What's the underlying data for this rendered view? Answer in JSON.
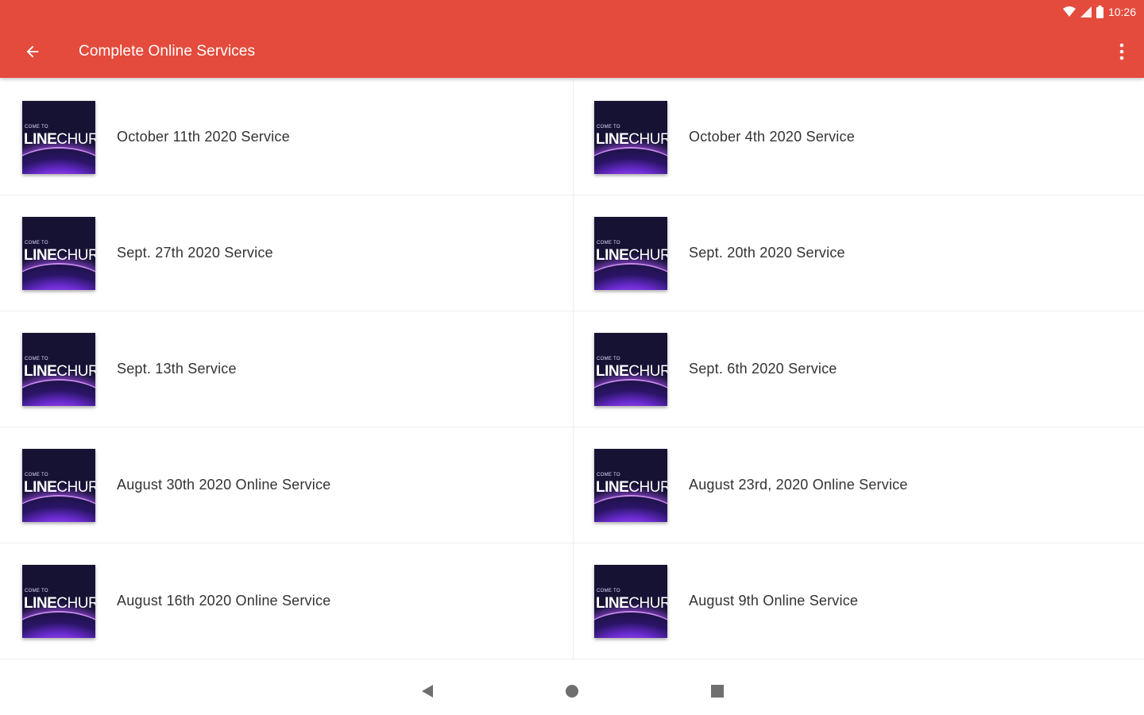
{
  "status_bar": {
    "time": "10:26"
  },
  "toolbar": {
    "title": "Complete Online Services",
    "back_icon": "arrow-back-icon",
    "menu_icon": "more-vert-icon"
  },
  "colors": {
    "accent": "#e44b3c",
    "text": "#333333"
  },
  "thumbnail": {
    "top_text": "COME TO",
    "brand_bold": "LINE",
    "brand_light": "CHUR"
  },
  "services": [
    {
      "title": "October 11th 2020 Service"
    },
    {
      "title": "October 4th 2020 Service"
    },
    {
      "title": "Sept. 27th 2020 Service"
    },
    {
      "title": "Sept. 20th 2020 Service"
    },
    {
      "title": "Sept. 13th Service"
    },
    {
      "title": "Sept. 6th 2020 Service"
    },
    {
      "title": "August 30th 2020 Online Service"
    },
    {
      "title": "August 23rd, 2020 Online Service"
    },
    {
      "title": "August 16th 2020 Online Service"
    },
    {
      "title": "August 9th Online Service"
    }
  ],
  "navbar": {
    "back": "nav-back-icon",
    "home": "nav-home-icon",
    "recents": "nav-recents-icon"
  }
}
